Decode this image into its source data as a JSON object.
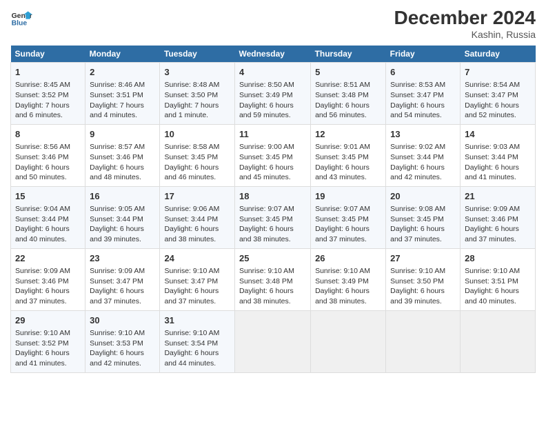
{
  "header": {
    "logo_line1": "General",
    "logo_line2": "Blue",
    "title": "December 2024",
    "subtitle": "Kashin, Russia"
  },
  "days_of_week": [
    "Sunday",
    "Monday",
    "Tuesday",
    "Wednesday",
    "Thursday",
    "Friday",
    "Saturday"
  ],
  "weeks": [
    [
      {
        "day": "1",
        "sunrise": "Sunrise: 8:45 AM",
        "sunset": "Sunset: 3:52 PM",
        "daylight": "Daylight: 7 hours and 6 minutes."
      },
      {
        "day": "2",
        "sunrise": "Sunrise: 8:46 AM",
        "sunset": "Sunset: 3:51 PM",
        "daylight": "Daylight: 7 hours and 4 minutes."
      },
      {
        "day": "3",
        "sunrise": "Sunrise: 8:48 AM",
        "sunset": "Sunset: 3:50 PM",
        "daylight": "Daylight: 7 hours and 1 minute."
      },
      {
        "day": "4",
        "sunrise": "Sunrise: 8:50 AM",
        "sunset": "Sunset: 3:49 PM",
        "daylight": "Daylight: 6 hours and 59 minutes."
      },
      {
        "day": "5",
        "sunrise": "Sunrise: 8:51 AM",
        "sunset": "Sunset: 3:48 PM",
        "daylight": "Daylight: 6 hours and 56 minutes."
      },
      {
        "day": "6",
        "sunrise": "Sunrise: 8:53 AM",
        "sunset": "Sunset: 3:47 PM",
        "daylight": "Daylight: 6 hours and 54 minutes."
      },
      {
        "day": "7",
        "sunrise": "Sunrise: 8:54 AM",
        "sunset": "Sunset: 3:47 PM",
        "daylight": "Daylight: 6 hours and 52 minutes."
      }
    ],
    [
      {
        "day": "8",
        "sunrise": "Sunrise: 8:56 AM",
        "sunset": "Sunset: 3:46 PM",
        "daylight": "Daylight: 6 hours and 50 minutes."
      },
      {
        "day": "9",
        "sunrise": "Sunrise: 8:57 AM",
        "sunset": "Sunset: 3:46 PM",
        "daylight": "Daylight: 6 hours and 48 minutes."
      },
      {
        "day": "10",
        "sunrise": "Sunrise: 8:58 AM",
        "sunset": "Sunset: 3:45 PM",
        "daylight": "Daylight: 6 hours and 46 minutes."
      },
      {
        "day": "11",
        "sunrise": "Sunrise: 9:00 AM",
        "sunset": "Sunset: 3:45 PM",
        "daylight": "Daylight: 6 hours and 45 minutes."
      },
      {
        "day": "12",
        "sunrise": "Sunrise: 9:01 AM",
        "sunset": "Sunset: 3:45 PM",
        "daylight": "Daylight: 6 hours and 43 minutes."
      },
      {
        "day": "13",
        "sunrise": "Sunrise: 9:02 AM",
        "sunset": "Sunset: 3:44 PM",
        "daylight": "Daylight: 6 hours and 42 minutes."
      },
      {
        "day": "14",
        "sunrise": "Sunrise: 9:03 AM",
        "sunset": "Sunset: 3:44 PM",
        "daylight": "Daylight: 6 hours and 41 minutes."
      }
    ],
    [
      {
        "day": "15",
        "sunrise": "Sunrise: 9:04 AM",
        "sunset": "Sunset: 3:44 PM",
        "daylight": "Daylight: 6 hours and 40 minutes."
      },
      {
        "day": "16",
        "sunrise": "Sunrise: 9:05 AM",
        "sunset": "Sunset: 3:44 PM",
        "daylight": "Daylight: 6 hours and 39 minutes."
      },
      {
        "day": "17",
        "sunrise": "Sunrise: 9:06 AM",
        "sunset": "Sunset: 3:44 PM",
        "daylight": "Daylight: 6 hours and 38 minutes."
      },
      {
        "day": "18",
        "sunrise": "Sunrise: 9:07 AM",
        "sunset": "Sunset: 3:45 PM",
        "daylight": "Daylight: 6 hours and 38 minutes."
      },
      {
        "day": "19",
        "sunrise": "Sunrise: 9:07 AM",
        "sunset": "Sunset: 3:45 PM",
        "daylight": "Daylight: 6 hours and 37 minutes."
      },
      {
        "day": "20",
        "sunrise": "Sunrise: 9:08 AM",
        "sunset": "Sunset: 3:45 PM",
        "daylight": "Daylight: 6 hours and 37 minutes."
      },
      {
        "day": "21",
        "sunrise": "Sunrise: 9:09 AM",
        "sunset": "Sunset: 3:46 PM",
        "daylight": "Daylight: 6 hours and 37 minutes."
      }
    ],
    [
      {
        "day": "22",
        "sunrise": "Sunrise: 9:09 AM",
        "sunset": "Sunset: 3:46 PM",
        "daylight": "Daylight: 6 hours and 37 minutes."
      },
      {
        "day": "23",
        "sunrise": "Sunrise: 9:09 AM",
        "sunset": "Sunset: 3:47 PM",
        "daylight": "Daylight: 6 hours and 37 minutes."
      },
      {
        "day": "24",
        "sunrise": "Sunrise: 9:10 AM",
        "sunset": "Sunset: 3:47 PM",
        "daylight": "Daylight: 6 hours and 37 minutes."
      },
      {
        "day": "25",
        "sunrise": "Sunrise: 9:10 AM",
        "sunset": "Sunset: 3:48 PM",
        "daylight": "Daylight: 6 hours and 38 minutes."
      },
      {
        "day": "26",
        "sunrise": "Sunrise: 9:10 AM",
        "sunset": "Sunset: 3:49 PM",
        "daylight": "Daylight: 6 hours and 38 minutes."
      },
      {
        "day": "27",
        "sunrise": "Sunrise: 9:10 AM",
        "sunset": "Sunset: 3:50 PM",
        "daylight": "Daylight: 6 hours and 39 minutes."
      },
      {
        "day": "28",
        "sunrise": "Sunrise: 9:10 AM",
        "sunset": "Sunset: 3:51 PM",
        "daylight": "Daylight: 6 hours and 40 minutes."
      }
    ],
    [
      {
        "day": "29",
        "sunrise": "Sunrise: 9:10 AM",
        "sunset": "Sunset: 3:52 PM",
        "daylight": "Daylight: 6 hours and 41 minutes."
      },
      {
        "day": "30",
        "sunrise": "Sunrise: 9:10 AM",
        "sunset": "Sunset: 3:53 PM",
        "daylight": "Daylight: 6 hours and 42 minutes."
      },
      {
        "day": "31",
        "sunrise": "Sunrise: 9:10 AM",
        "sunset": "Sunset: 3:54 PM",
        "daylight": "Daylight: 6 hours and 44 minutes."
      },
      null,
      null,
      null,
      null
    ]
  ]
}
